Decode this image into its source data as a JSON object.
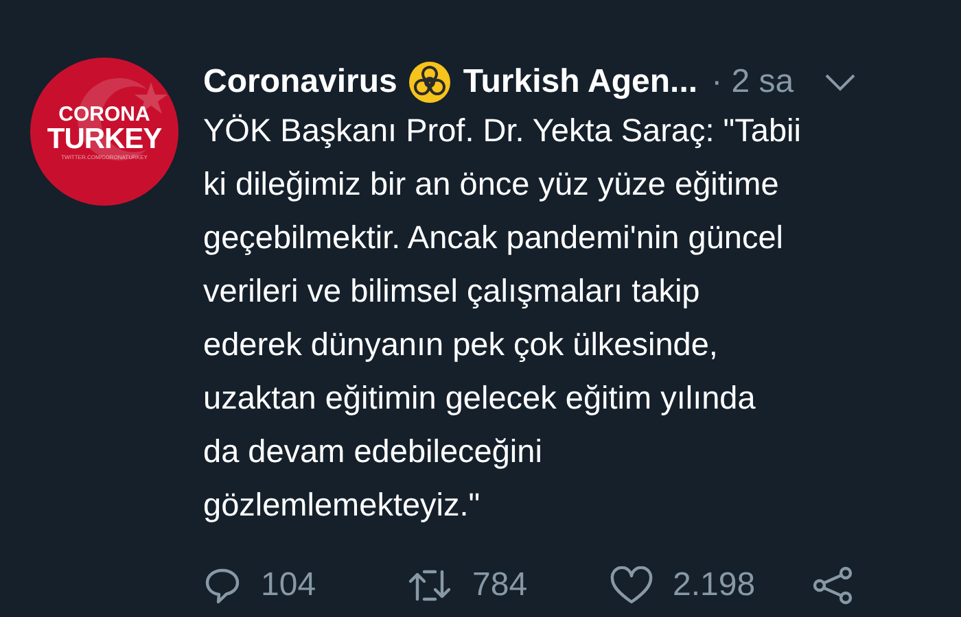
{
  "avatar": {
    "line_1": "CORONA",
    "line_2": "TURKEY",
    "line_3": "TWITTER.COM/CORONATURKEY"
  },
  "header": {
    "name_start": "Coronavirus",
    "name_end": "Turkish Agen...",
    "time": "· 2 sa"
  },
  "body_lines": [
    "YÖK Başkanı Prof. Dr. Yekta Saraç: \"Tabii",
    "ki dileğimiz bir an önce yüz yüze eğitime",
    "geçebilmektir. Ancak pandemi'nin güncel",
    "verileri ve bilimsel çalışmaları takip",
    "ederek dünyanın pek çok ülkesinde,",
    "uzaktan eğitimin gelecek eğitim yılında",
    "da devam edebileceğini",
    "gözlemlemekteyiz.\""
  ],
  "actions": [
    {
      "kind": "reply",
      "count": "104"
    },
    {
      "kind": "retweet",
      "count": "784"
    },
    {
      "kind": "like",
      "count": "2.198"
    },
    {
      "kind": "share"
    }
  ]
}
